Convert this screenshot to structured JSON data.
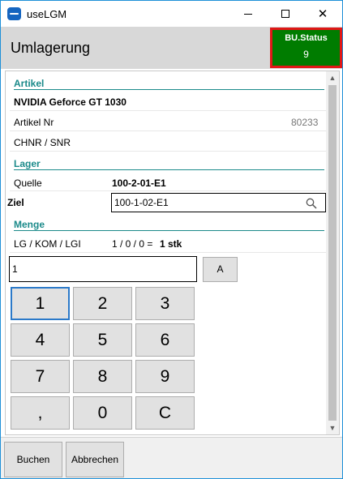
{
  "window": {
    "title": "useLGM",
    "minimize_label": "",
    "maximize_label": "",
    "close_label": "✕"
  },
  "header": {
    "title": "Umlagerung",
    "bu_status_label": "BU.Status",
    "bu_status_value": "9",
    "bu_status_color": "#007c00",
    "bu_status_border_color": "#e11717"
  },
  "artikel": {
    "section": "Artikel",
    "name": "NVIDIA Geforce GT 1030",
    "nr_label": "Artikel Nr",
    "nr_value": "80233",
    "chnr_label": "CHNR / SNR"
  },
  "lager": {
    "section": "Lager",
    "quelle_label": "Quelle",
    "quelle_value": "100-2-01-E1",
    "ziel_label": "Ziel",
    "ziel_value": "100-1-02-E1"
  },
  "menge": {
    "section": "Menge",
    "label": "LG / KOM / LGI",
    "values": "1 / 0 / 0 =",
    "total": "1 stk",
    "input_value": "1",
    "a_button": "A"
  },
  "keypad": {
    "keys": [
      "1",
      "2",
      "3",
      "4",
      "5",
      "6",
      "7",
      "8",
      "9",
      ",",
      "0",
      "C"
    ]
  },
  "footer": {
    "buchen": "Buchen",
    "abbrechen": "Abbrechen"
  },
  "accent_color": "#1b8a8a"
}
